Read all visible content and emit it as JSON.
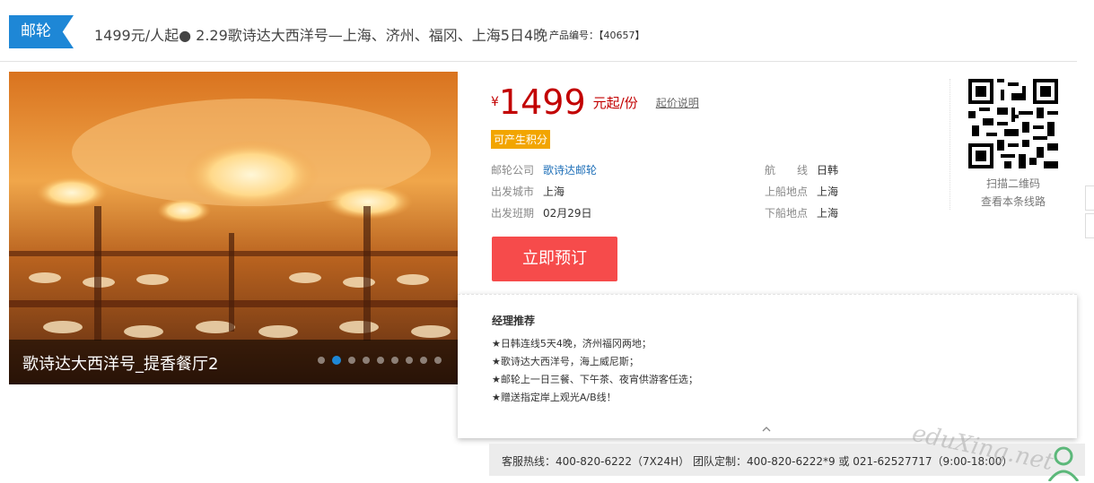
{
  "header": {
    "tag": "邮轮",
    "title": "1499元/人起● 2.29歌诗达大西洋号—上海、济州、福冈、上海5日4晚",
    "product_label": "产品编号：",
    "product_code": "【40657】"
  },
  "gallery": {
    "caption": "歌诗达大西洋号_提香餐厅2",
    "slide_count": 9,
    "active_index": 1
  },
  "price": {
    "currency": "¥",
    "amount": "1499",
    "unit": "元起/份",
    "note_link": "起价说明",
    "points_badge": "可产生积分"
  },
  "info": {
    "company_label": "邮轮公司",
    "company_value": "歌诗达邮轮",
    "route_label": "航　　线",
    "route_value": "日韩",
    "depart_city_label": "出发城市",
    "depart_city_value": "上海",
    "board_label": "上船地点",
    "board_value": "上海",
    "schedule_label": "出发班期",
    "schedule_value": "02月29日",
    "alight_label": "下船地点",
    "alight_value": "上海"
  },
  "book_button": "立即预订",
  "qr": {
    "line1": "扫描二维码",
    "line2": "查看本条线路"
  },
  "recommend": {
    "title": "经理推荐",
    "items": [
      "★日韩连线5天4晚，济州福冈两地；",
      "★歌诗达大西洋号，海上威尼斯；",
      "★邮轮上一日三餐、下午茶、夜宵供游客任选；",
      "★赠送指定岸上观光A/B线！"
    ]
  },
  "footer": {
    "hotline": "客服热线：400-820-6222（7X24H） 团队定制：400-820-6222*9 或 021-62527717（9:00-18:00）"
  },
  "watermark": "eduXing.net",
  "colors": {
    "brand_blue": "#1e87d6",
    "price_red": "#c20000",
    "book_red": "#f64b4b",
    "badge_orange": "#f2a500"
  }
}
